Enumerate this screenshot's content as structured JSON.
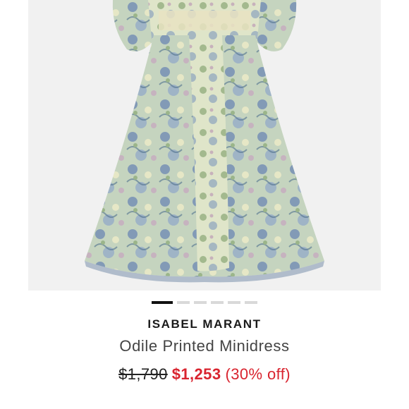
{
  "product": {
    "image_alt": "Floral printed minidress",
    "carousel": {
      "total": 6,
      "active_index": 0
    },
    "brand": "ISABEL MARANT",
    "name": "Odile Printed Minidress",
    "price_original": "$1,790",
    "price_sale": "$1,253",
    "discount": "(30% off)"
  },
  "colors": {
    "sale": "#d9242f",
    "panel_bg": "#f1f1f1",
    "dress_base": "#c8d6c0",
    "dress_blue": "#6f88b4",
    "dress_green": "#a9c09a",
    "dress_cream": "#e8e8c8"
  }
}
